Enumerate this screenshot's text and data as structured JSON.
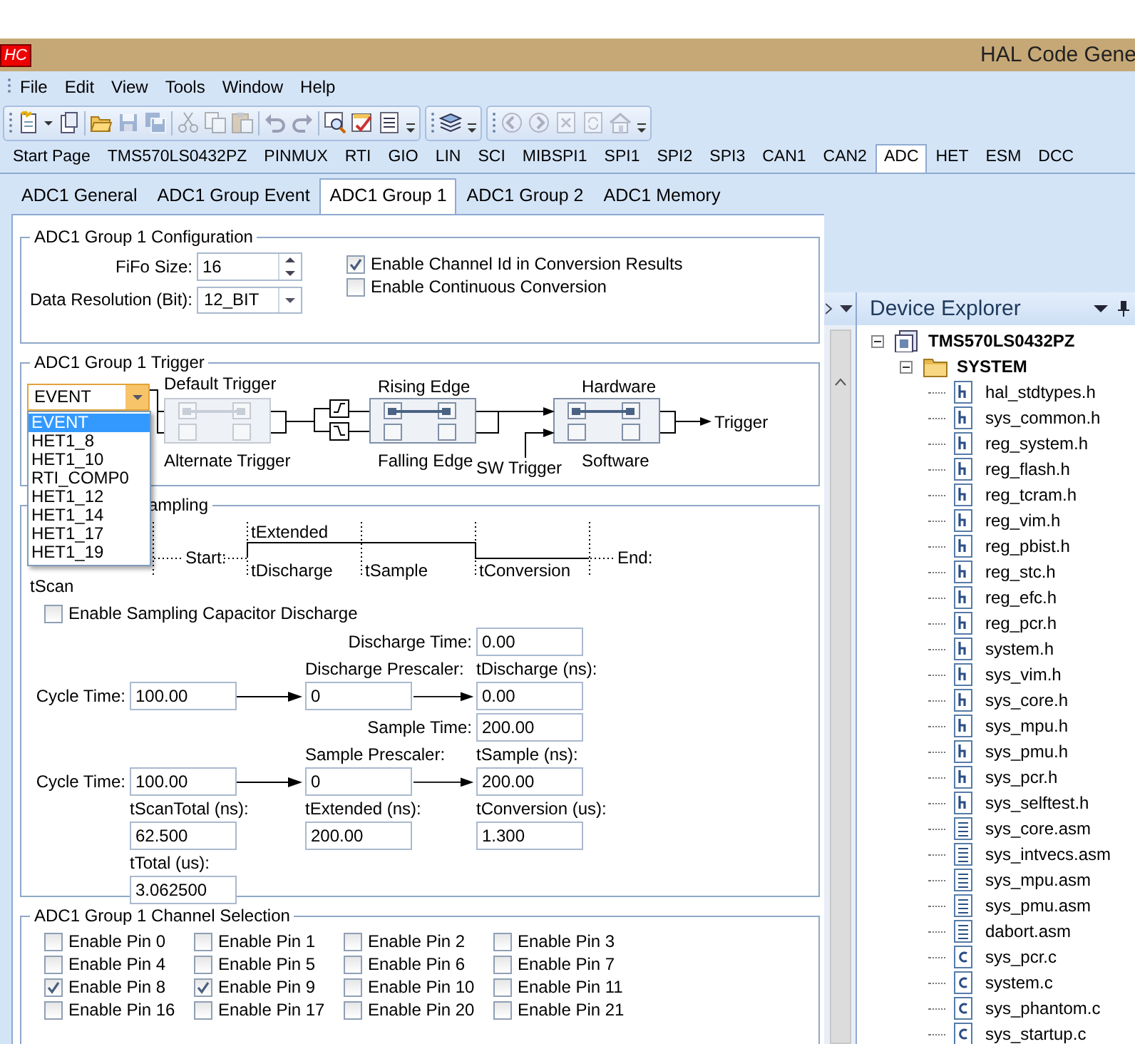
{
  "window": {
    "logo": "HC",
    "title": "HAL Code Gene"
  },
  "menu": [
    "File",
    "Edit",
    "View",
    "Tools",
    "Window",
    "Help"
  ],
  "toolbar": [
    [
      {
        "kind": "new",
        "disabled": false,
        "caret": true
      },
      {
        "kind": "document",
        "disabled": false
      },
      {
        "kind": "open",
        "disabled": false
      },
      {
        "kind": "save",
        "disabled": true
      },
      {
        "kind": "save-all",
        "disabled": true
      },
      {
        "kind": "cut",
        "disabled": true
      },
      {
        "kind": "copy",
        "disabled": true
      },
      {
        "kind": "paste",
        "disabled": true
      },
      {
        "kind": "undo",
        "disabled": true
      },
      {
        "kind": "redo",
        "disabled": true
      },
      {
        "kind": "search",
        "disabled": false
      },
      {
        "kind": "check",
        "disabled": false
      },
      {
        "kind": "list",
        "disabled": false
      }
    ],
    [
      {
        "kind": "layers",
        "disabled": false
      }
    ],
    [
      {
        "kind": "back",
        "disabled": true
      },
      {
        "kind": "forward",
        "disabled": true
      },
      {
        "kind": "close",
        "disabled": true
      },
      {
        "kind": "refresh",
        "disabled": true
      },
      {
        "kind": "home",
        "disabled": true
      }
    ]
  ],
  "module_tabs": [
    {
      "label": "Start Page",
      "selected": false
    },
    {
      "label": "TMS570LS0432PZ",
      "selected": false
    },
    {
      "label": "PINMUX",
      "selected": false
    },
    {
      "label": "RTI",
      "selected": false
    },
    {
      "label": "GIO",
      "selected": false
    },
    {
      "label": "LIN",
      "selected": false
    },
    {
      "label": "SCI",
      "selected": false
    },
    {
      "label": "MIBSPI1",
      "selected": false
    },
    {
      "label": "SPI1",
      "selected": false
    },
    {
      "label": "SPI2",
      "selected": false
    },
    {
      "label": "SPI3",
      "selected": false
    },
    {
      "label": "CAN1",
      "selected": false
    },
    {
      "label": "CAN2",
      "selected": false
    },
    {
      "label": "ADC",
      "selected": true
    },
    {
      "label": "HET",
      "selected": false
    },
    {
      "label": "ESM",
      "selected": false
    },
    {
      "label": "DCC",
      "selected": false
    }
  ],
  "sub_tabs": [
    {
      "label": "ADC1 General",
      "selected": false
    },
    {
      "label": "ADC1 Group Event",
      "selected": false
    },
    {
      "label": "ADC1 Group 1",
      "selected": true
    },
    {
      "label": "ADC1 Group 2",
      "selected": false
    },
    {
      "label": "ADC1 Memory",
      "selected": false
    }
  ],
  "configuration": {
    "title": "ADC1 Group 1 Configuration",
    "fifo_label": "FiFo Size:",
    "fifo_value": "16",
    "resolution_label": "Data Resolution (Bit):",
    "resolution_value": "12_BIT",
    "options": [
      {
        "label": "Enable Channel Id in Conversion Results",
        "checked": true
      },
      {
        "label": "Enable Continuous Conversion",
        "checked": false
      }
    ]
  },
  "trigger": {
    "title": "ADC1 Group 1 Trigger",
    "source": "EVENT",
    "expanded": true,
    "options": [
      {
        "label": "EVENT",
        "selected": true
      },
      {
        "label": "HET1_8",
        "selected": false
      },
      {
        "label": "HET1_10",
        "selected": false
      },
      {
        "label": "RTI_COMP0",
        "selected": false
      },
      {
        "label": "HET1_12",
        "selected": false
      },
      {
        "label": "HET1_14",
        "selected": false
      },
      {
        "label": "HET1_17",
        "selected": false
      },
      {
        "label": "HET1_19",
        "selected": false
      }
    ],
    "switches": [
      {
        "top": "Default Trigger",
        "bottom": "Alternate Trigger",
        "top_selected": true,
        "disabled": true
      },
      {
        "top": "Rising Edge",
        "bottom": "Falling Edge",
        "top_selected": true,
        "disabled": false
      },
      {
        "top": "Hardware",
        "bottom": "Software",
        "top_selected": true,
        "disabled": false
      }
    ],
    "sw_trigger": "SW Trigger",
    "output": "Trigger"
  },
  "sampling": {
    "title": "ampling",
    "timeline": {
      "scan": "tScan",
      "start": "Start:",
      "extended": "tExtended",
      "discharge": "tDischarge",
      "sample": "tSample",
      "conversion": "tConversion",
      "end": "End:"
    },
    "discharge_enable": {
      "label": "Enable Sampling Capacitor Discharge",
      "checked": false
    },
    "discharge_time": {
      "label": "Discharge Time:",
      "value": "0.00"
    },
    "discharge_row": {
      "cycle_label": "Cycle Time:",
      "cycle": "100.00",
      "prescaler_label": "Discharge Prescaler:",
      "prescaler": "0",
      "result_label": "tDischarge (ns):",
      "result": "0.00"
    },
    "sample_time": {
      "label": "Sample Time:",
      "value": "200.00"
    },
    "sample_row": {
      "cycle_label": "Cycle Time:",
      "cycle": "100.00",
      "prescaler_label": "Sample Prescaler:",
      "prescaler": "0",
      "result_label": "tSample (ns):",
      "result": "200.00"
    },
    "totals": [
      {
        "label": "tScanTotal (ns):",
        "value": "62.500"
      },
      {
        "label": "tExtended (ns):",
        "value": "200.00"
      },
      {
        "label": "tConversion (us):",
        "value": "1.300"
      }
    ],
    "total": {
      "label": "tTotal (us):",
      "value": "3.062500"
    }
  },
  "channels": {
    "title": "ADC1 Group 1 Channel Selection",
    "pins": [
      {
        "label": "Enable Pin 0",
        "checked": false
      },
      {
        "label": "Enable Pin 1",
        "checked": false
      },
      {
        "label": "Enable Pin 2",
        "checked": false
      },
      {
        "label": "Enable Pin 3",
        "checked": false
      },
      {
        "label": "Enable Pin 4",
        "checked": false
      },
      {
        "label": "Enable Pin 5",
        "checked": false
      },
      {
        "label": "Enable Pin 6",
        "checked": false
      },
      {
        "label": "Enable Pin 7",
        "checked": false
      },
      {
        "label": "Enable Pin 8",
        "checked": true
      },
      {
        "label": "Enable Pin 9",
        "checked": true
      },
      {
        "label": "Enable Pin 10",
        "checked": false
      },
      {
        "label": "Enable Pin 11",
        "checked": false
      },
      {
        "label": "Enable Pin 16",
        "checked": false
      },
      {
        "label": "Enable Pin 17",
        "checked": false
      },
      {
        "label": "Enable Pin 20",
        "checked": false
      },
      {
        "label": "Enable Pin 21",
        "checked": false
      }
    ]
  },
  "explorer": {
    "title": "Device Explorer",
    "tree": [
      {
        "label": "TMS570LS0432PZ",
        "kind": "device",
        "expanded": true,
        "children": [
          {
            "label": "SYSTEM",
            "kind": "folder",
            "expanded": true,
            "children": [
              {
                "label": "hal_stdtypes.h",
                "kind": "h"
              },
              {
                "label": "sys_common.h",
                "kind": "h"
              },
              {
                "label": "reg_system.h",
                "kind": "h"
              },
              {
                "label": "reg_flash.h",
                "kind": "h"
              },
              {
                "label": "reg_tcram.h",
                "kind": "h"
              },
              {
                "label": "reg_vim.h",
                "kind": "h"
              },
              {
                "label": "reg_pbist.h",
                "kind": "h"
              },
              {
                "label": "reg_stc.h",
                "kind": "h"
              },
              {
                "label": "reg_efc.h",
                "kind": "h"
              },
              {
                "label": "reg_pcr.h",
                "kind": "h"
              },
              {
                "label": "system.h",
                "kind": "h"
              },
              {
                "label": "sys_vim.h",
                "kind": "h"
              },
              {
                "label": "sys_core.h",
                "kind": "h"
              },
              {
                "label": "sys_mpu.h",
                "kind": "h"
              },
              {
                "label": "sys_pmu.h",
                "kind": "h"
              },
              {
                "label": "sys_pcr.h",
                "kind": "h"
              },
              {
                "label": "sys_selftest.h",
                "kind": "h"
              },
              {
                "label": "sys_core.asm",
                "kind": "asm"
              },
              {
                "label": "sys_intvecs.asm",
                "kind": "asm"
              },
              {
                "label": "sys_mpu.asm",
                "kind": "asm"
              },
              {
                "label": "sys_pmu.asm",
                "kind": "asm"
              },
              {
                "label": "dabort.asm",
                "kind": "asm"
              },
              {
                "label": "sys_pcr.c",
                "kind": "c"
              },
              {
                "label": "system.c",
                "kind": "c"
              },
              {
                "label": "sys_phantom.c",
                "kind": "c"
              },
              {
                "label": "sys_startup.c",
                "kind": "c"
              }
            ]
          }
        ]
      }
    ]
  }
}
